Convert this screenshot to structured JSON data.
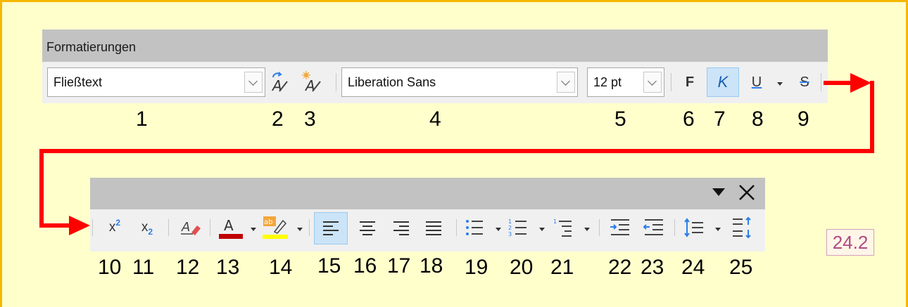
{
  "toolbar1": {
    "title": "Formatierungen",
    "paragraph_style": "Fließtext",
    "font_name": "Liberation Sans",
    "font_size": "12 pt",
    "bold_label": "F",
    "italic_label": "K",
    "underline_label": "U",
    "strike_label": "S"
  },
  "toolbar2": {
    "superscript_label": "x²",
    "subscript_label": "x₂"
  },
  "numbers": [
    "1",
    "2",
    "3",
    "4",
    "5",
    "6",
    "7",
    "8",
    "9",
    "10",
    "11",
    "12",
    "13",
    "14",
    "15",
    "16",
    "17",
    "18",
    "19",
    "20",
    "21",
    "22",
    "23",
    "24",
    "25"
  ],
  "badge": "24.2",
  "colors": {
    "frame_bg": "#ffffcc",
    "frame_border": "#f5b800",
    "arrow": "#ff0000",
    "font_color_bar": "#c00000",
    "highlight_bar": "#ffff00",
    "selected": "#cce4f7",
    "badge_text": "#b04a86"
  },
  "icons": [
    "update-style-icon",
    "new-style-icon",
    "bold-icon",
    "italic-icon",
    "underline-icon",
    "strikethrough-icon",
    "superscript-icon",
    "subscript-icon",
    "clear-formatting-icon",
    "font-color-icon",
    "highlight-icon",
    "align-left-icon",
    "align-center-icon",
    "align-right-icon",
    "justify-icon",
    "bullet-list-icon",
    "numbered-list-icon",
    "outline-list-icon",
    "increase-indent-icon",
    "decrease-indent-icon",
    "line-spacing-icon",
    "paragraph-spacing-icon",
    "dropdown-arrow-icon",
    "close-icon"
  ]
}
